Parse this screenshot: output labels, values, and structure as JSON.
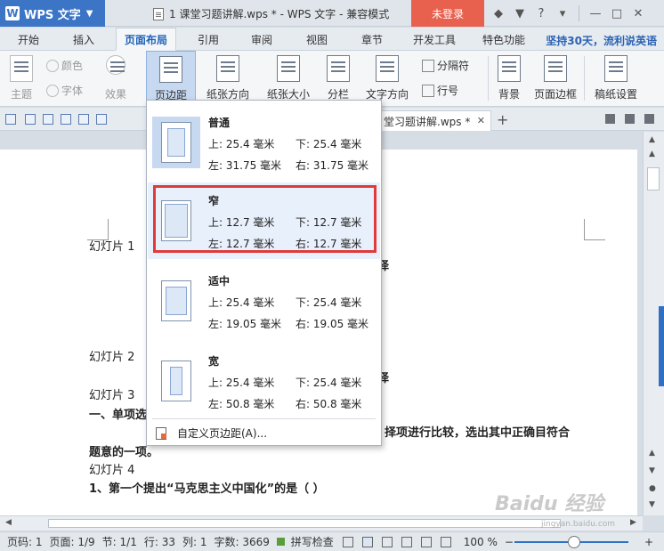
{
  "app": {
    "name": "WPS 文字",
    "logo": "W"
  },
  "title": {
    "doc": "1 课堂习题讲解.wps * - WPS 文字 - 兼容模式",
    "login": "未登录"
  },
  "menu": {
    "tabs": [
      "开始",
      "插入",
      "页面布局",
      "引用",
      "审阅",
      "视图",
      "章节",
      "开发工具",
      "特色功能"
    ],
    "active": "页面布局",
    "promo": "坚持30天，流利说英语"
  },
  "ribbon": {
    "theme": "主题",
    "color": "颜色",
    "font": "字体",
    "effect": "效果",
    "margins": "页边距",
    "orientation": "纸张方向",
    "size": "纸张大小",
    "columns": "分栏",
    "text_direction": "文字方向",
    "breaks": "分隔符",
    "line_numbers": "行号",
    "background": "背景",
    "page_border": "页面边框",
    "paper_setup": "稿纸设置"
  },
  "doctab": {
    "name": "堂习题讲解.wps *"
  },
  "document": {
    "lines": [
      "幻灯片 1",
      "幻灯片 2",
      "幻灯片 3",
      "一、单项选",
      "择项进行比较，选出其中正确目符合",
      "题意的一项。",
      "幻灯片 4",
      "1、第一个提出“马克思主义中国化”的是（    ）"
    ],
    "fragments": [
      "择",
      "择"
    ]
  },
  "margins_menu": {
    "options": [
      {
        "name": "普通",
        "top": "上: 25.4 毫米",
        "bottom": "下: 25.4 毫米",
        "left": "左: 31.75 毫米",
        "right": "右: 31.75 毫米"
      },
      {
        "name": "窄",
        "top": "上: 12.7 毫米",
        "bottom": "下: 12.7 毫米",
        "left": "左: 12.7 毫米",
        "right": "右: 12.7 毫米"
      },
      {
        "name": "适中",
        "top": "上: 25.4 毫米",
        "bottom": "下: 25.4 毫米",
        "left": "左: 19.05 毫米",
        "right": "右: 19.05 毫米"
      },
      {
        "name": "宽",
        "top": "上: 25.4 毫米",
        "bottom": "下: 25.4 毫米",
        "left": "左: 50.8 毫米",
        "right": "右: 50.8 毫米"
      }
    ],
    "custom": "自定义页边距(A)..."
  },
  "status": {
    "page_code": "页码: 1",
    "page": "页面: 1/9",
    "section": "节: 1/1",
    "line": "行: 33",
    "column": "列: 1",
    "words": "字数: 3669",
    "spell": "拼写检查",
    "zoom": "100 %"
  },
  "watermark": {
    "text": "Baidu 经验",
    "sub": "jingyan.baidu.com"
  },
  "colors": {
    "accent": "#3c75c6",
    "login": "#e8614f",
    "highlight": "#e03a3a"
  }
}
